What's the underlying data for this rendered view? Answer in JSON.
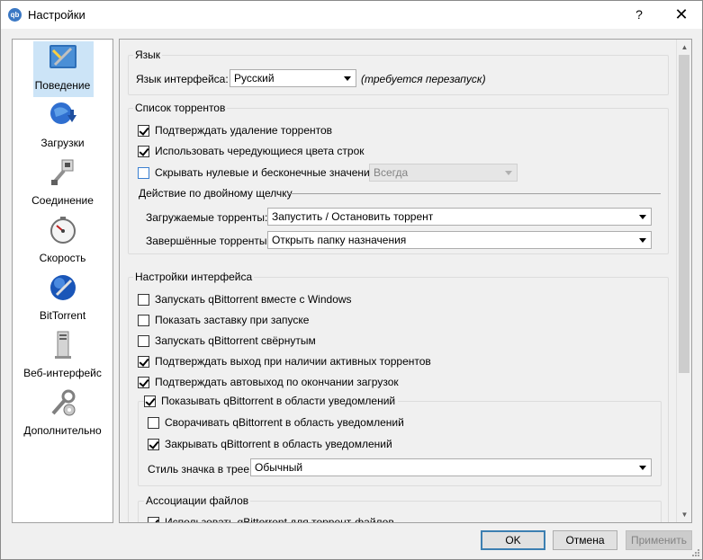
{
  "window": {
    "title": "Настройки",
    "help_glyph": "?",
    "close_glyph": "✕",
    "app_icon_text": "qb"
  },
  "sidebar": {
    "items": [
      {
        "label": "Поведение",
        "icon": "behavior-icon",
        "selected": true
      },
      {
        "label": "Загрузки",
        "icon": "downloads-icon"
      },
      {
        "label": "Соединение",
        "icon": "connection-icon"
      },
      {
        "label": "Скорость",
        "icon": "speed-icon"
      },
      {
        "label": "BitTorrent",
        "icon": "bittorrent-icon"
      },
      {
        "label": "Веб-интерфейс",
        "icon": "webui-icon"
      },
      {
        "label": "Дополнительно",
        "icon": "advanced-icon"
      }
    ]
  },
  "language": {
    "group_title": "Язык",
    "label": "Язык интерфейса:",
    "value": "Русский",
    "note": "(требуется перезапуск)"
  },
  "torrent_list": {
    "group_title": "Список торрентов",
    "confirm_delete": "Подтверждать удаление торрентов",
    "alt_row_colors": "Использовать чередующиеся цвета строк",
    "hide_zero": "Скрывать нулевые и бесконечные значения",
    "hide_zero_combo": "Всегда",
    "double_click_title": "Действие по двойному щелчку",
    "downloading_label": "Загружаемые торренты:",
    "downloading_value": "Запустить / Остановить торрент",
    "completed_label": "Завершённые торренты:",
    "completed_value": "Открыть папку назначения"
  },
  "interface": {
    "group_title": "Настройки интерфейса",
    "start_with_windows": "Запускать qBittorrent вместе с Windows",
    "show_splash": "Показать заставку при запуске",
    "start_minimized": "Запускать qBittorrent свёрнутым",
    "confirm_exit": "Подтверждать выход при наличии активных торрентов",
    "confirm_autoexit": "Подтверждать автовыход по окончании загрузок",
    "show_tray": "Показывать qBittorrent в области уведомлений",
    "minimize_tray": "Сворачивать qBittorrent в область уведомлений",
    "close_tray": "Закрывать qBittorrent в область уведомлений",
    "tray_style_label": "Стиль значка в трее:",
    "tray_style_value": "Обычный"
  },
  "file_assoc": {
    "group_title": "Ассоциации файлов",
    "use_for_torrents": "Использовать qBittorrent для торрент-файлов"
  },
  "buttons": {
    "ok": "OK",
    "cancel": "Отмена",
    "apply": "Применить"
  },
  "colors": {
    "selection": "#cce4f7",
    "accent": "#3c7fb1"
  }
}
